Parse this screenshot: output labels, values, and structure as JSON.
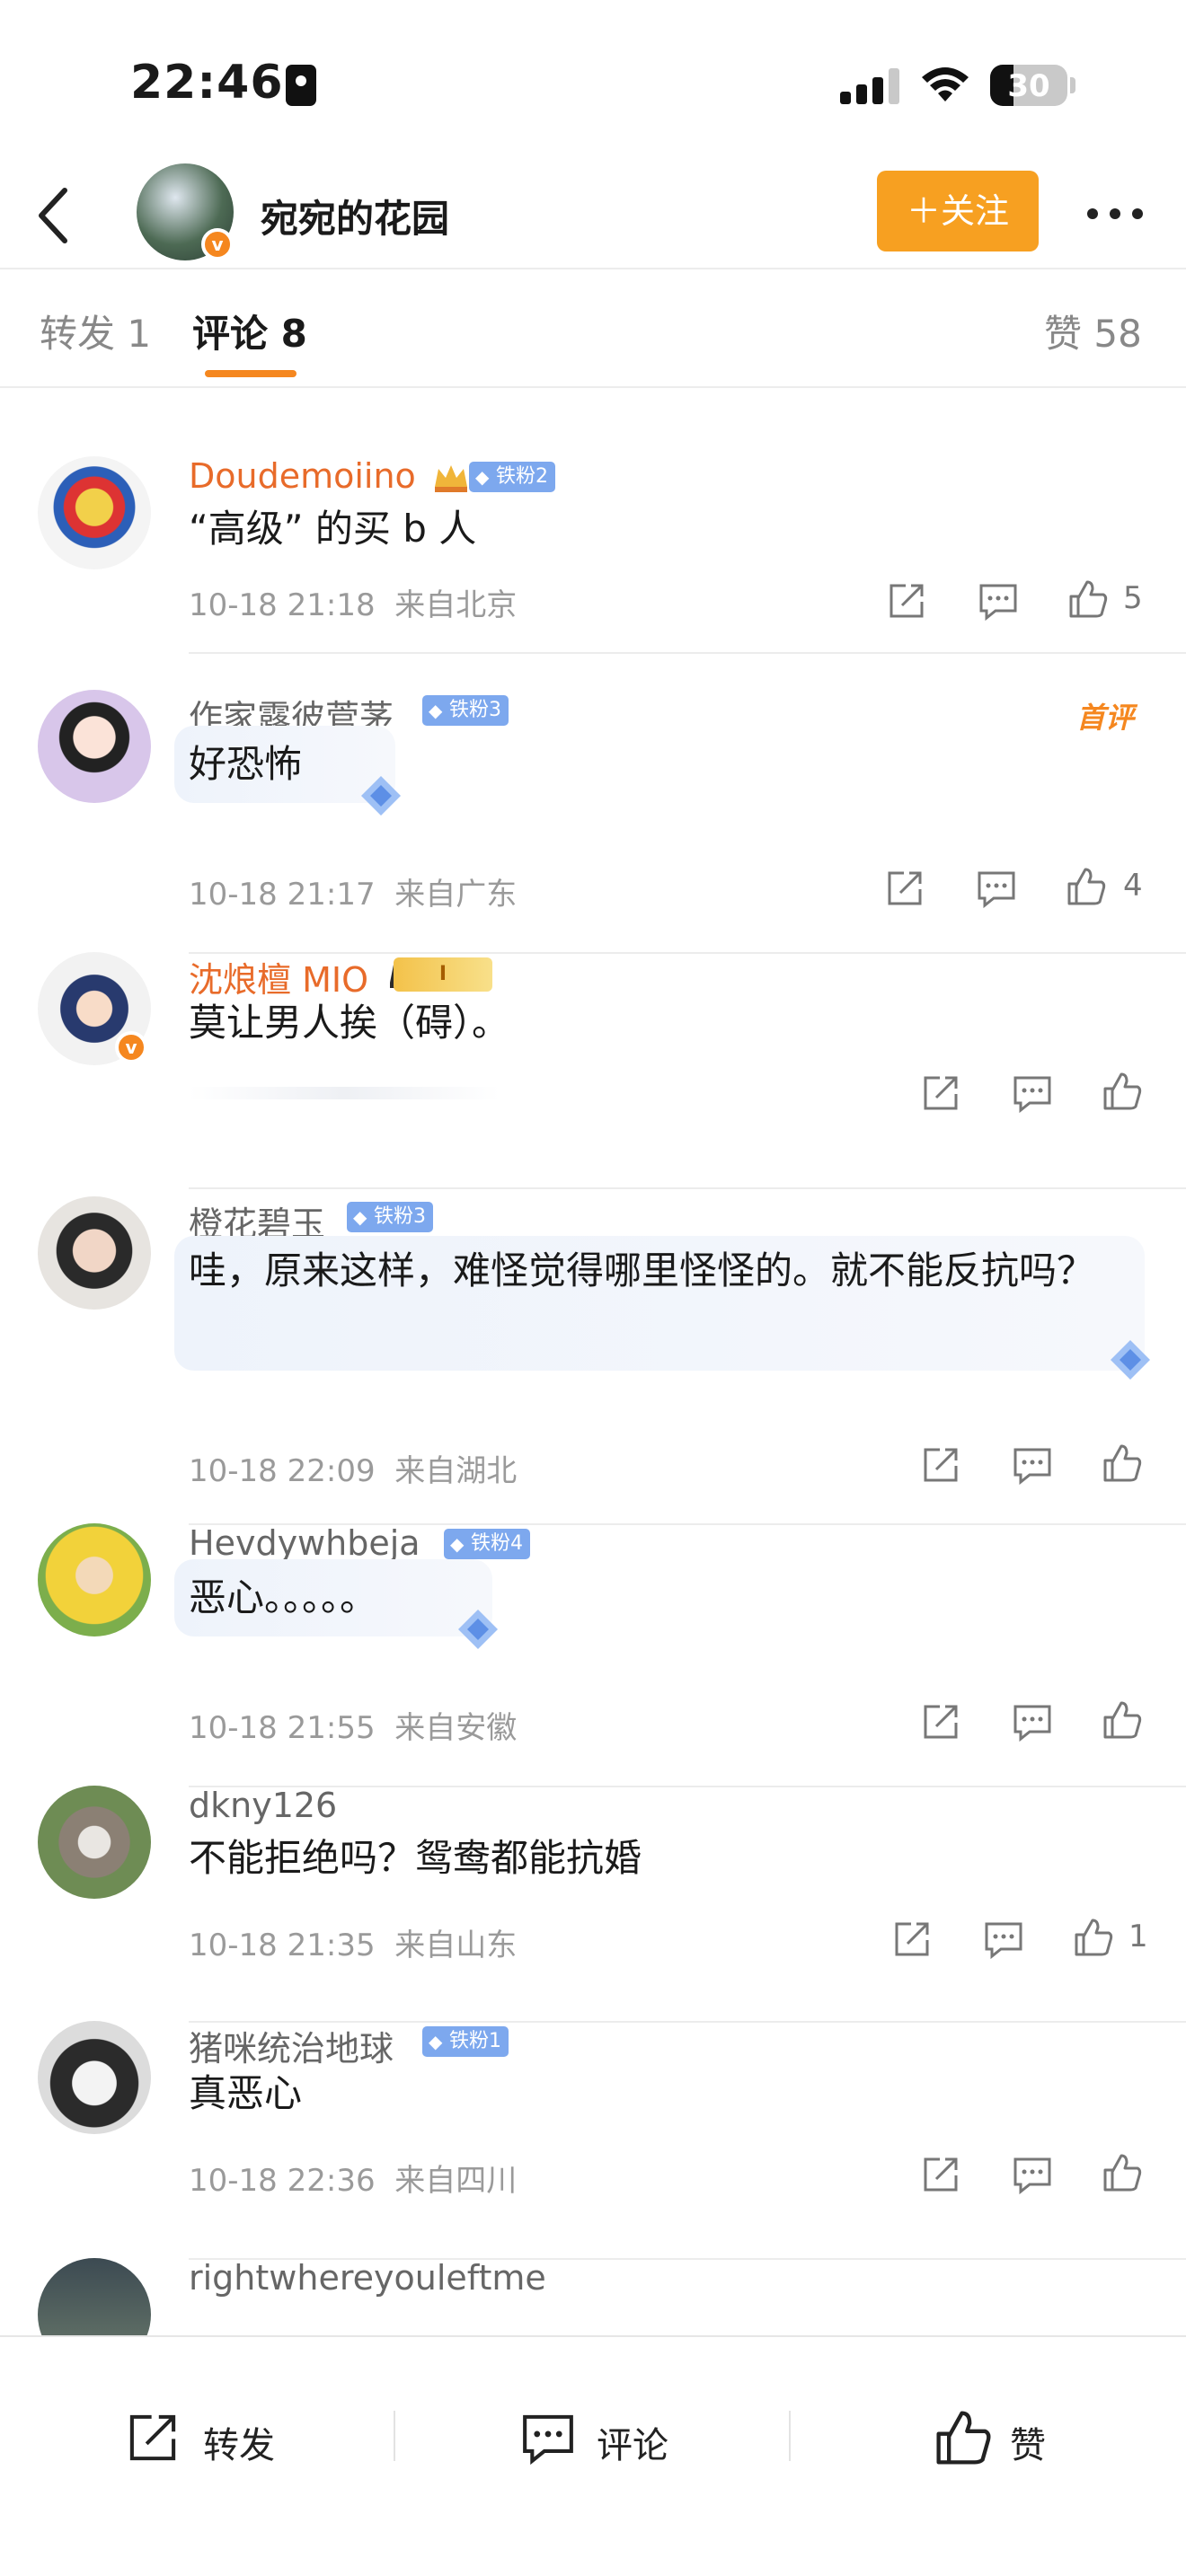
{
  "status_bar": {
    "time": "22:46",
    "battery": "30",
    "battery_level": 0.3
  },
  "header": {
    "title": "宛宛的花园",
    "follow_label": "＋关注"
  },
  "tabs": [
    {
      "label": "转发",
      "count": "1"
    },
    {
      "label": "评论",
      "count": "8"
    },
    {
      "label": "赞",
      "count": "58"
    }
  ],
  "comments": [
    {
      "name": "Doudemoiino",
      "badge": "铁粉2",
      "text": "“高级” 的买 b 人",
      "time": "10-18 21:18",
      "location": "来自北京",
      "likes": "5"
    },
    {
      "name": "作家露彼菅茅",
      "badge": "铁粉3",
      "tag": "首评",
      "text": "好恐怖",
      "time": "10-18 21:17",
      "location": "来自广东",
      "likes": "4"
    },
    {
      "name": "沈烺檀 MIO",
      "badge": "I",
      "text": "莫让男人挨（碍）。",
      "time": "",
      "location": "",
      "likes": ""
    },
    {
      "name": "橙花碧玉",
      "badge": "铁粉3",
      "text": "哇，原来这样，难怪觉得哪里怪怪的。就不能反抗吗？",
      "time": "10-18 22:09",
      "location": "来自湖北",
      "likes": ""
    },
    {
      "name": "Hevdywhbeja",
      "badge": "铁粉4",
      "text": "恶心。。。。。",
      "time": "10-18 21:55",
      "location": "来自安徽",
      "likes": ""
    },
    {
      "name": "dkny126",
      "badge": "",
      "text": "不能拒绝吗？鸳鸯都能抗婚",
      "time": "10-18 21:35",
      "location": "来自山东",
      "likes": "1"
    },
    {
      "name": "猪咪统治地球",
      "badge": "铁粉1",
      "text": "真恶心",
      "time": "10-18 22:36",
      "location": "来自四川",
      "likes": ""
    },
    {
      "name": "rightwhereyouleftme",
      "badge": "",
      "text": "",
      "time": "",
      "location": "",
      "likes": ""
    }
  ],
  "toolbar": {
    "repost": "转发",
    "comment": "评论",
    "like": "赞"
  },
  "colors": {
    "accent": "#f5871f",
    "follow": "#f7a021",
    "fan_badge": "#7da8ee",
    "vip_name": "#e86b2a"
  }
}
